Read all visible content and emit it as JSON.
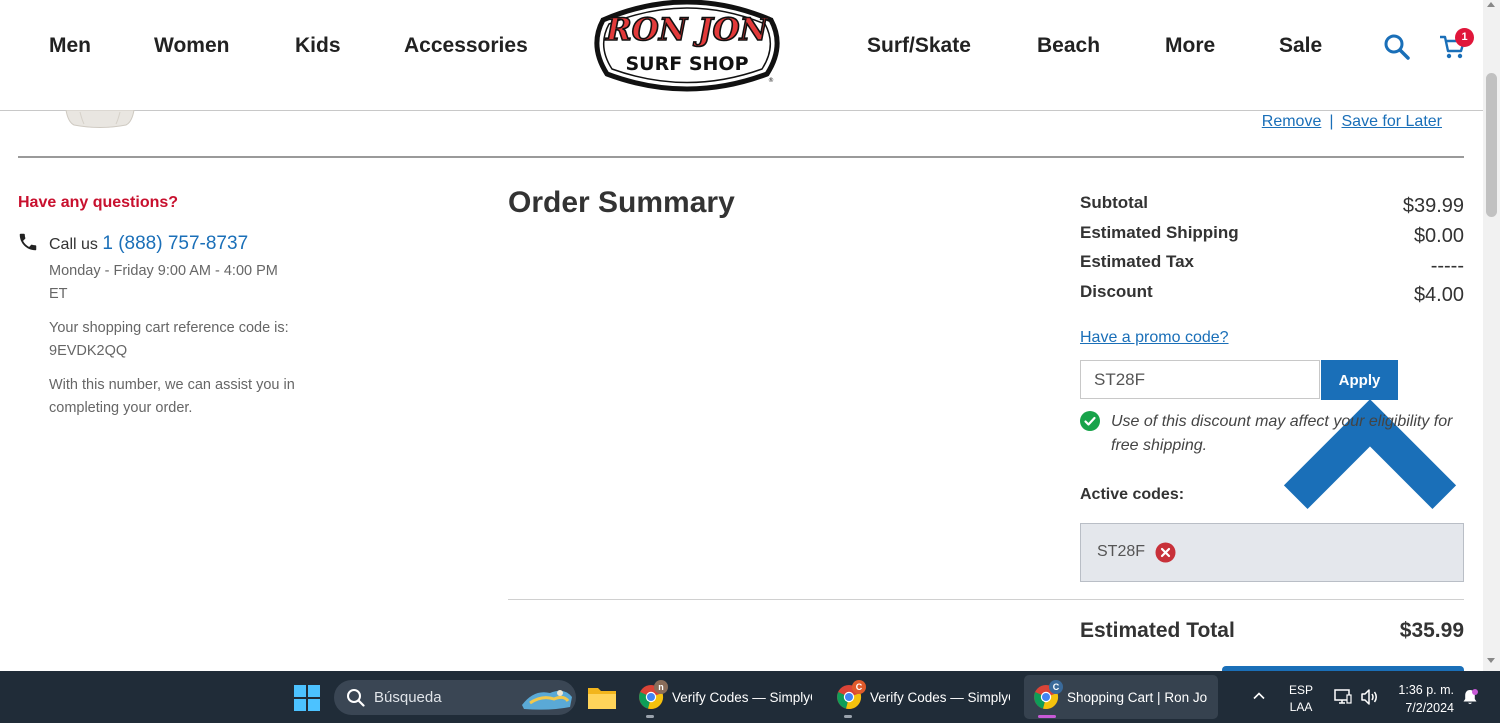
{
  "header": {
    "nav_left": [
      "Men",
      "Women",
      "Kids",
      "Accessories"
    ],
    "nav_right": [
      "Surf/Skate",
      "Beach",
      "More",
      "Sale"
    ],
    "logo": {
      "top_text": "RON JON",
      "bottom_text": "SURF SHOP"
    },
    "cart_count": "1"
  },
  "cart_item": {
    "remove_label": "Remove",
    "separator": "|",
    "save_label": "Save for Later"
  },
  "help": {
    "title": "Have any questions?",
    "call_prefix": "Call us",
    "phone": "1 (888) 757-8737",
    "hours": "Monday - Friday 9:00 AM - 4:00 PM ET",
    "reference": "Your shopping cart reference code is: 9EVDK2QQ",
    "assist": "With this number, we can assist you in completing your order."
  },
  "summary": {
    "title": "Order Summary",
    "subtotal_label": "Subtotal",
    "subtotal_value": "$39.99",
    "shipping_label": "Estimated Shipping",
    "shipping_value": "$0.00",
    "tax_label": "Estimated Tax",
    "tax_value": "-----",
    "discount_label": "Discount",
    "discount_value": "$4.00",
    "promo_toggle": "Have a promo code?",
    "promo_value": "ST28F",
    "apply_label": "Apply",
    "notice": "Use of this discount may affect your eligibility for free shipping.",
    "active_codes_label": "Active codes:",
    "active_code": "ST28F",
    "total_label": "Estimated Total",
    "total_value": "$35.99"
  },
  "taskbar": {
    "search_placeholder": "Búsqueda",
    "apps": [
      {
        "label": "Verify Codes — SimplyC",
        "badge": "n",
        "badge_color": "#8a6d5a"
      },
      {
        "label": "Verify Codes — SimplyC",
        "badge": "C",
        "badge_color": "#e05a2b"
      },
      {
        "label": "Shopping Cart | Ron Jor",
        "badge": "C",
        "badge_color": "#3a6a9a"
      }
    ],
    "lang_top": "ESP",
    "lang_bottom": "LAA",
    "time": "1:36 p. m.",
    "date": "7/2/2024"
  },
  "colors": {
    "accent": "#1a6fb8",
    "help_title": "#c8102e",
    "cart_badge": "#e0163a",
    "taskbar": "#202c38"
  }
}
